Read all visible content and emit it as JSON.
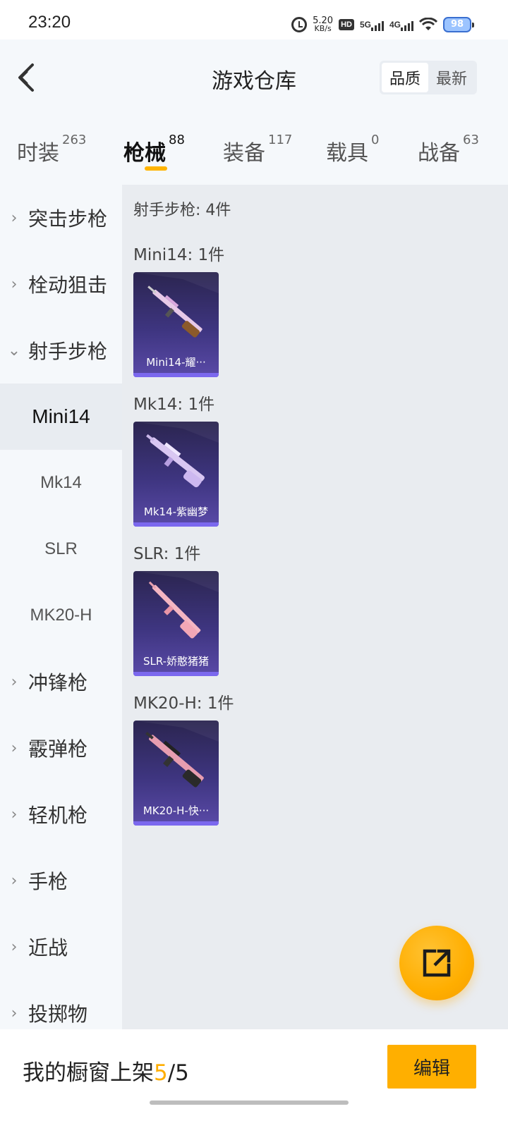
{
  "status": {
    "time": "23:20",
    "net_speed_value": "5.20",
    "net_speed_unit": "KB/s",
    "hd_label": "HD",
    "sim1_label": "5G",
    "sim2_label": "4G",
    "battery": "98"
  },
  "header": {
    "title": "游戏仓库",
    "sort_options": [
      "品质",
      "最新"
    ]
  },
  "tabs": [
    {
      "label": "时装",
      "count": "263"
    },
    {
      "label": "枪械",
      "count": "88"
    },
    {
      "label": "装备",
      "count": "117"
    },
    {
      "label": "载具",
      "count": "0"
    },
    {
      "label": "战备",
      "count": "63"
    }
  ],
  "sidebar": {
    "categories": [
      "突击步枪",
      "栓动狙击",
      "射手步枪"
    ],
    "subitems": [
      "Mini14",
      "Mk14",
      "SLR",
      "MK20-H"
    ],
    "more_categories": [
      "冲锋枪",
      "霰弹枪",
      "轻机枪",
      "手枪",
      "近战",
      "投掷物"
    ]
  },
  "content": {
    "section_title": "射手步枪: 4件",
    "groups": [
      {
        "title": "Mini14: 1件",
        "card_label": "Mini14-耀···"
      },
      {
        "title": "Mk14: 1件",
        "card_label": "Mk14-紫幽梦"
      },
      {
        "title": "SLR: 1件",
        "card_label": "SLR-娇憨猪猪"
      },
      {
        "title": "MK20-H: 1件",
        "card_label": "MK20-H-快···"
      }
    ]
  },
  "bottom": {
    "shelf_prefix": "我的橱窗上架",
    "shelf_current": "5",
    "shelf_sep_total": "/5",
    "edit_label": "编辑"
  },
  "icons": {
    "back": "back-arrow-icon",
    "fab": "share-out-icon"
  },
  "colors": {
    "accent": "#ffae00",
    "card_bg": "#3e3580"
  }
}
